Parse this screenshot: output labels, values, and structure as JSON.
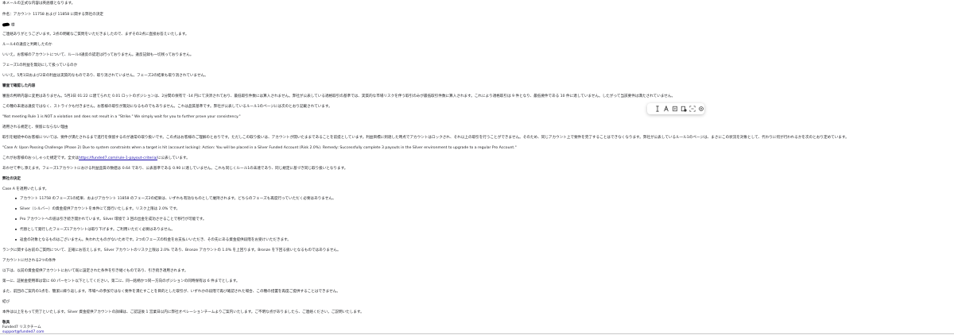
{
  "lines": [
    "本メールの正式な内容は英語版となります。",
    "件名：アカウント 11758 および 11858 に関する弊社の決定",
    "様",
    "ご連絡ありがとうございます。2点の明確なご質問をいただきましたので、まずその2点に直接お答えいたします。",
    "ルール4の違反と判断したのか",
    "いいえ。お客様のアカウントについて、ルール4違反の認定は行っておりません。違反記録も一切残っておりません。",
    "フェーズ1の利益を無効にして扱っているのか",
    "いいえ。5月1日および2日の利益は実質的なものであり、取り消されていません。フェーズ2の結果も取り消されていません。",
    "審査で確認した内容",
    "審査の判断内容に変更はありません。5月3日 01:22 に建てられた 0.01 ロットのポジションは、2分間の保有で -14 円にて決済されており、最低取引件数には算入されません。弊社が公表している適格取引の基準では、実質的な市場リスクを伴う取引のみが最低取引件数に算入されます。これにより適格取引は 9 件となり、最低要件である 10 件に達していません。したがって当該要件は満たされていません。",
    "この種の未達は違反ではなく、ストライクも付きません。お客様の取引が無効になるものでもありません。これは品質基準です。弊社が公表しているルール1のページには次のとおり記載されています。",
    "\"Not meeting Rule 1 is NOT a violation and does not result in a \"Strike.\" We simply wait for you to further prove your consistency.\"",
    "適用される規定と、保留にならない理由",
    "取引を継続中のお客様については、要件が満たされるまで進行を保留するのが通常の取り扱いです。この点はお客様のご理解のとおりです。ただしこの取り扱いは、アカウントが開いたままであることを前提としています。利益目標に到達した時点でアカウントはロックされ、それ以上の取引を行うことができません。そのため、同じアカウント上で要件を完了することはできなくなります。弊社が公表しているルール1のページは、まさにこの状況を対象として、代わりに何が行われるかを次のとおり定めています。",
    "\"Case A: Upon Passing Challenge (Phase 2) Due to system constraints when a target is hit (account locking): Action: You will be placed in a Silver Funded Account (Risk 2.0%). Remedy: Successfully complete 3 payouts in the Silver environment to upgrade to a regular Pro Account.\"",
    "これがお客様のおっしゃった規定です。全文は",
    "https://funded7.com/rule-1-payout-criteria/",
    "に公表しています。",
    "あわせて申し添えます。フェーズ1アカウントにおける利益品質の数値は 0.64 であり、公表基準である 0.90 に達していません。これも同じくルール1の未達であり、同じ規定に基づき同じ取り扱いとなります。",
    "弊社の決定",
    "Case A を適用いたします。",
    "アカウントに付される2つの条件",
    "以下は、以前の資金提供アカウントにおいて既に設定された条件を引き継ぐものであり、引き続き適用されます。",
    "第一に、証拠金使用率は常に 60 パーセント以下としてください。第二に、同一銘柄かつ同一方向のポジションの同時保有は 6 件までとします。",
    "また、前回のご案内の1点を、簡潔に繰り返します。市場への参加ではなく要件を満たすことを目的とした取引が、いずれかの段階で再び確認された場合、この種の措置を再度ご提供することはできません。",
    "結び",
    "本件は以上をもって完了といたします。Silver 資金提供アカウントの詳細は、ご認証後 1 営業日以内に弊社オペレーションチームよりご案内いたします。ご不明な点がありましたら、ご連絡ください。ご説明いたします。",
    "敬具",
    "Funded7 リスクチーム",
    "support@funded7.com"
  ],
  "bullets": [
    "アカウント 11758 のフェーズ1の結果、およびアカウント 11858 のフェーズ2の結果は、いずれも有効なものとして維持されます。どちらのフェーズも再度行っていただく必要はありません。",
    "Silver（シルバー）の資金提供アカウントを本件にて発行いたします。リスク上限は 2.0% です。",
    "Pro アカウントへの道は引き続き開かれています。Silver 環境で 3 回の出金を成功させることで移行が可能です。",
    "代替として発行したフェーズ1アカウントは取り下げます。ご利用いただく必要はありません。",
    "返金の対象となるものはございません。失われたものがないためです。2つのフェーズの料金をお支払いいただき、その先にある資金提供段階をお受けいただきます。"
  ],
  "extra_line": "ランクに関するお前のご質問について、正確にお答えします。Silver アカウントのリスク上限は 2.0% であり、Bronze アカウントの 1.0% を上回ります。Bronze を下回る扱いとなるものではありません。",
  "toolbar": {
    "tools": [
      "cursor-text-icon",
      "font-icon",
      "note-icon",
      "add-page-icon",
      "ocr-icon",
      "settings-icon"
    ]
  },
  "colors": {
    "text": "#202124",
    "link": "#1a0dab"
  }
}
